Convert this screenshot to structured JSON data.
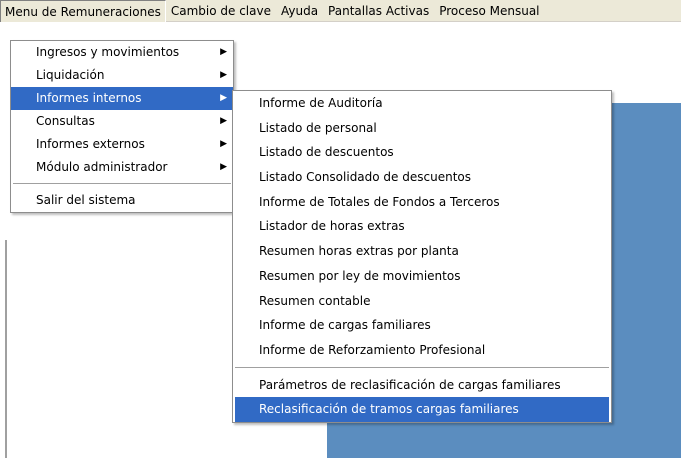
{
  "menubar": {
    "items": [
      {
        "label": "Menu de Remuneraciones"
      },
      {
        "label": "Cambio de clave"
      },
      {
        "label": "Ayuda"
      },
      {
        "label": "Pantallas Activas"
      },
      {
        "label": "Proceso Mensual"
      }
    ]
  },
  "main_menu": {
    "items": [
      {
        "label": "Ingresos y movimientos",
        "arrow": "▶"
      },
      {
        "label": "Liquidación",
        "arrow": "▶"
      },
      {
        "label": "Informes internos",
        "arrow": "▶"
      },
      {
        "label": "Consultas",
        "arrow": "▶"
      },
      {
        "label": "Informes externos",
        "arrow": "▶"
      },
      {
        "label": "Módulo administrador",
        "arrow": "▶"
      }
    ],
    "exit_label": "Salir del sistema"
  },
  "submenu": {
    "items": [
      {
        "label": "Informe de Auditoría"
      },
      {
        "label": "Listado de personal"
      },
      {
        "label": "Listado de descuentos"
      },
      {
        "label": "Listado Consolidado de descuentos"
      },
      {
        "label": "Informe de Totales de Fondos a Terceros"
      },
      {
        "label": "Listador de horas extras"
      },
      {
        "label": "Resumen horas extras por planta"
      },
      {
        "label": "Resumen por ley de movimientos"
      },
      {
        "label": "Resumen contable"
      },
      {
        "label": "Informe de cargas familiares"
      },
      {
        "label": "Informe de Reforzamiento Profesional"
      }
    ],
    "extra_items": [
      {
        "label": "Parámetros de reclasificación de cargas familiares"
      },
      {
        "label": "Reclasificación de tramos cargas familiares"
      }
    ]
  },
  "colors": {
    "highlight": "#316ac5",
    "background_panel": "#5b8dbf",
    "menubar": "#ece9d8"
  }
}
